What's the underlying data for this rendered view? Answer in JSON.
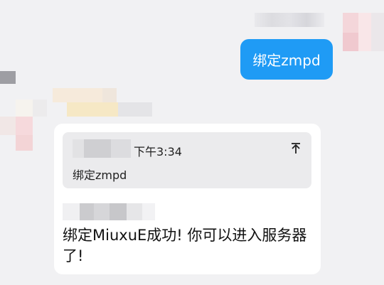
{
  "outgoing_message": {
    "text": "绑定zmpd"
  },
  "incoming_message": {
    "quote": {
      "time": "下午3:34",
      "text": "绑定zmpd",
      "collapse_icon": "collapse-arrow-icon"
    },
    "text": "绑定MiuxuE成功! 你可以进入服务器了!"
  },
  "colors": {
    "background": "#f1f1f3",
    "outgoing_bubble": "#1f9bf5",
    "incoming_bubble": "#ffffff",
    "quote_background": "#ebebed"
  }
}
